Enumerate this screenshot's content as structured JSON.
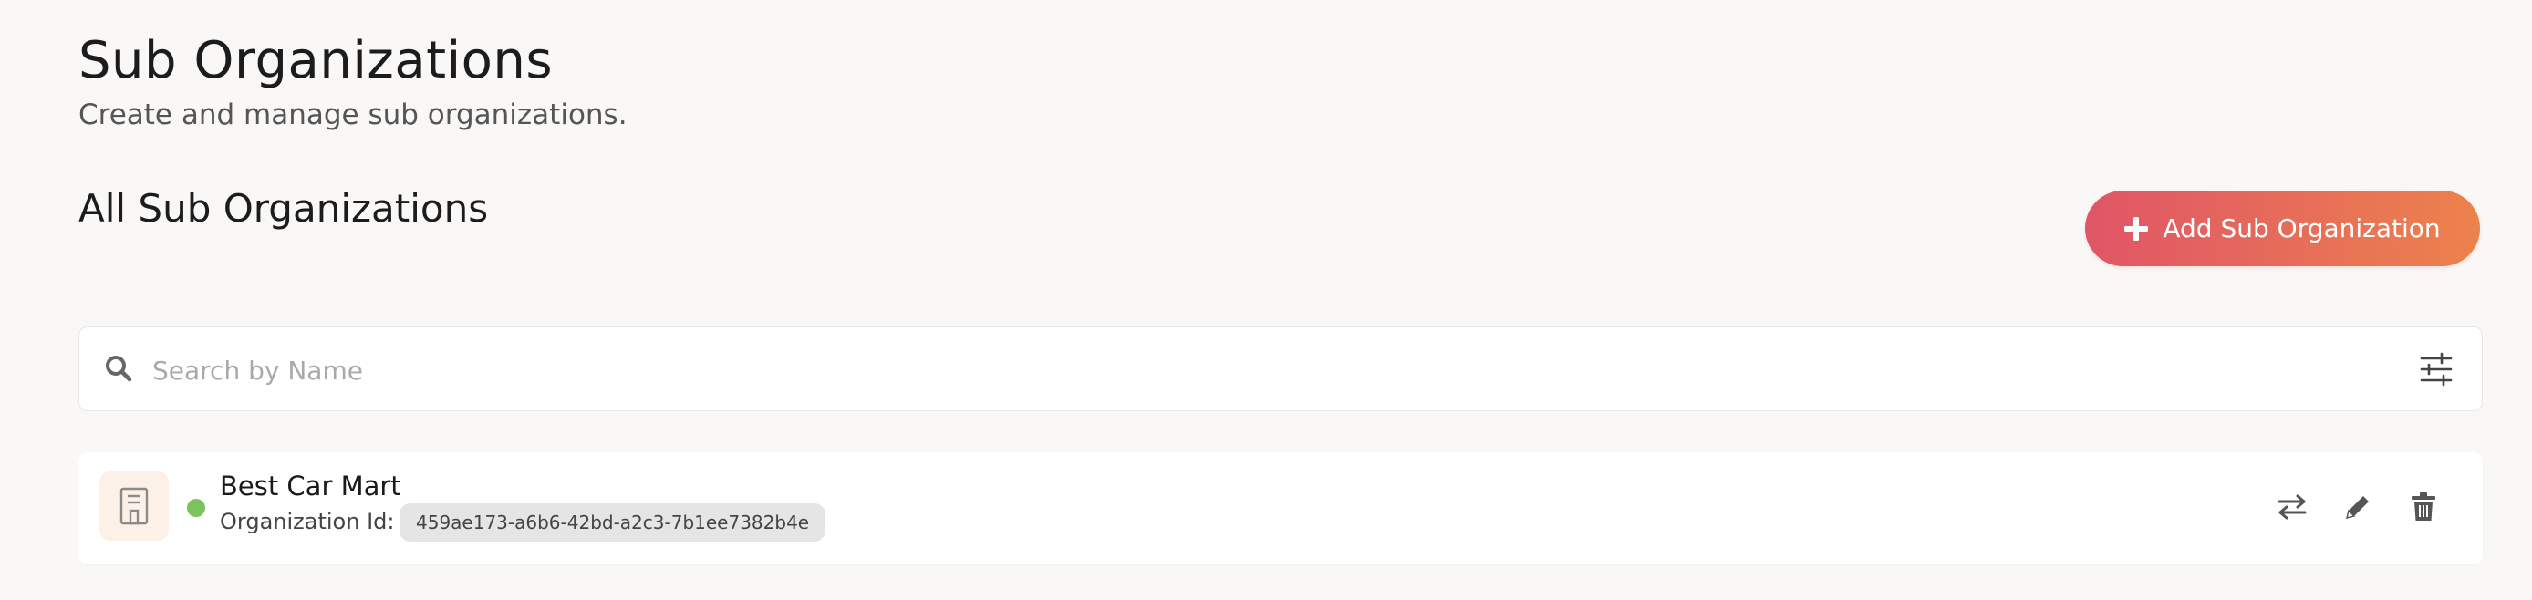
{
  "header": {
    "title": "Sub Organizations",
    "subtitle": "Create and manage sub organizations."
  },
  "section": {
    "title": "All Sub Organizations",
    "add_button": {
      "label": "Add Sub Organization",
      "icon": "plus-icon"
    }
  },
  "search": {
    "placeholder": "Search by Name",
    "value": "",
    "icons": [
      "search-icon",
      "filter-sliders-icon"
    ]
  },
  "organizations": [
    {
      "name": "Best Car Mart",
      "id_label": "Organization Id:",
      "id": "459ae173-a6b6-42bd-a2c3-7b1ee7382b4e",
      "status": "active",
      "status_color": "#7cc25d",
      "icon": "building-icon",
      "actions": [
        "switch-icon",
        "edit-icon",
        "delete-icon"
      ]
    }
  ],
  "colors": {
    "background": "#f9f8f6",
    "accent_start": "#e05567",
    "accent_end": "#ec824c"
  }
}
